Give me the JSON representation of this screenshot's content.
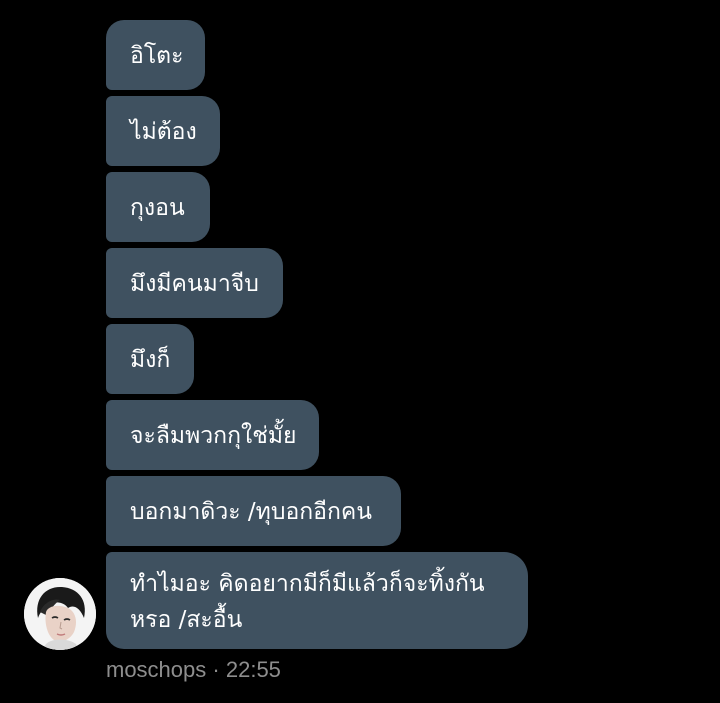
{
  "messages": [
    {
      "text": "อิโตะ"
    },
    {
      "text": "ไม่ต้อง"
    },
    {
      "text": "กุงอน"
    },
    {
      "text": "มึงมีคนมาจีบ"
    },
    {
      "text": "มึงก็"
    },
    {
      "text": "จะลืมพวกกุใช่มั้ย"
    },
    {
      "text": "บอกมาดิวะ /ทุบอกอีกคน"
    },
    {
      "text": "ทำไมอะ คิดอยากมีก็มีแล้วก็จะทิ้งกันหรอ /สะอื้น"
    }
  ],
  "sender": {
    "name": "moschops",
    "separator": "·",
    "time": "22:55"
  },
  "colors": {
    "background": "#000000",
    "bubble": "#3f5160",
    "text": "#ffffff",
    "meta": "#8e8e8e"
  },
  "icons": {
    "avatar": "avatar-photo-icon"
  }
}
